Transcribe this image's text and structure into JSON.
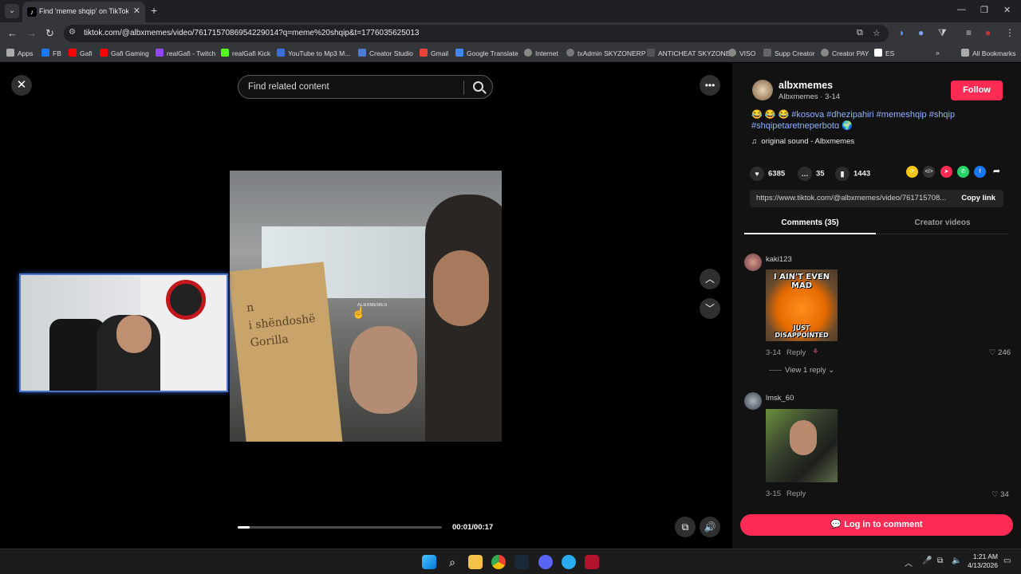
{
  "browser": {
    "tab_title": "Find 'meme shqip' on TikTok | T",
    "url": "tiktok.com/@albxmemes/video/7617157086954229014?q=meme%20shqip&t=1776035625013",
    "bookmarks": [
      "Apps",
      "FB",
      "Gafi",
      "Gafi Gaming",
      "realGafi - Twitch",
      "realGafi Kick",
      "YouTube to Mp3 M...",
      "Creator Studio",
      "Gmail",
      "Google Translate",
      "Internet",
      "txAdmin SKYZONERP",
      "ANTICHEAT SKYZONE",
      "VISO",
      "Supp Creator",
      "Creator PAY",
      "ES"
    ],
    "all_bookmarks": "All Bookmarks"
  },
  "player": {
    "search_placeholder": "Find related content",
    "time": "00:01/00:17",
    "progress": 0.06,
    "watermark": "ALBXMEMES"
  },
  "post": {
    "username": "albxmemes",
    "subtitle": "Albxmemes · 3-14",
    "follow_label": "Follow",
    "emojis": "😂 😂 😂",
    "hashtags": "#kosova #dhezipahiri #memeshqip #shqip #shqipetaretneperbotɑ 🌍",
    "sound": "original sound - Albxmemes",
    "likes": "6385",
    "comments": "35",
    "saves": "1443",
    "link": "https://www.tiktok.com/@albxmemes/video/761715708...",
    "copy_link": "Copy link",
    "tab_comments": "Comments (35)",
    "tab_creator": "Creator videos",
    "login_label": "Log in to comment"
  },
  "comments": [
    {
      "user": "kaki123",
      "meme_top": "I AIN'T EVEN MAD",
      "meme_bottom": "JUST DISAPPOINTED",
      "date": "3-14",
      "reply": "Reply",
      "likes": "246",
      "view_replies": "View 1 reply"
    },
    {
      "user": "lmsk_60",
      "date": "3-15",
      "reply": "Reply",
      "likes": "34"
    }
  ],
  "taskbar": {
    "time": "1:21 AM",
    "date": "4/13/2026"
  },
  "colors": {
    "accent": "#fe2c55",
    "hashtag": "#8fb3ff",
    "panel_bg": "#121212",
    "cam_border": "#4a74c9"
  }
}
